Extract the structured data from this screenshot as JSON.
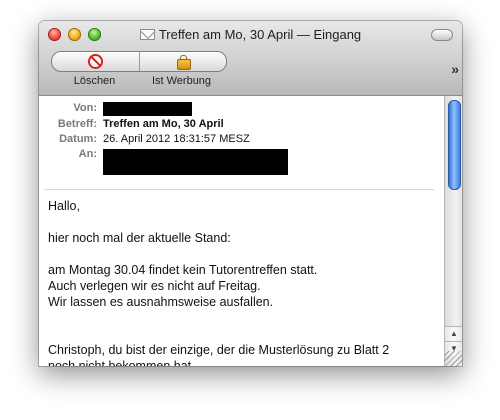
{
  "window": {
    "title": "Treffen am Mo, 30 April — Eingang"
  },
  "toolbar": {
    "delete_label": "Löschen",
    "junk_label": "Ist Werbung"
  },
  "headers": {
    "from_label": "Von:",
    "subject_label": "Betreff:",
    "subject_value": "Treffen am Mo, 30 April",
    "date_label": "Datum:",
    "date_value": "26. April 2012 18:31:57 MESZ",
    "to_label": "An:"
  },
  "body": {
    "greeting": "Hallo,",
    "line1": "hier noch mal der aktuelle Stand:",
    "line2": "am Montag 30.04 findet kein Tutorentreffen statt.",
    "line3": "Auch verlegen wir es nicht auf Freitag.",
    "line4": "Wir lassen es ausnahmsweise ausfallen.",
    "line5": "Christoph, du bist der einzige, der die Musterlösung zu Blatt 2",
    "line6": "noch nicht bekommen hat,"
  },
  "icons": {
    "delete": "delete-icon",
    "junk": "junk-icon",
    "mail": "envelope-icon",
    "overflow": "chevron-double-right-icon"
  }
}
